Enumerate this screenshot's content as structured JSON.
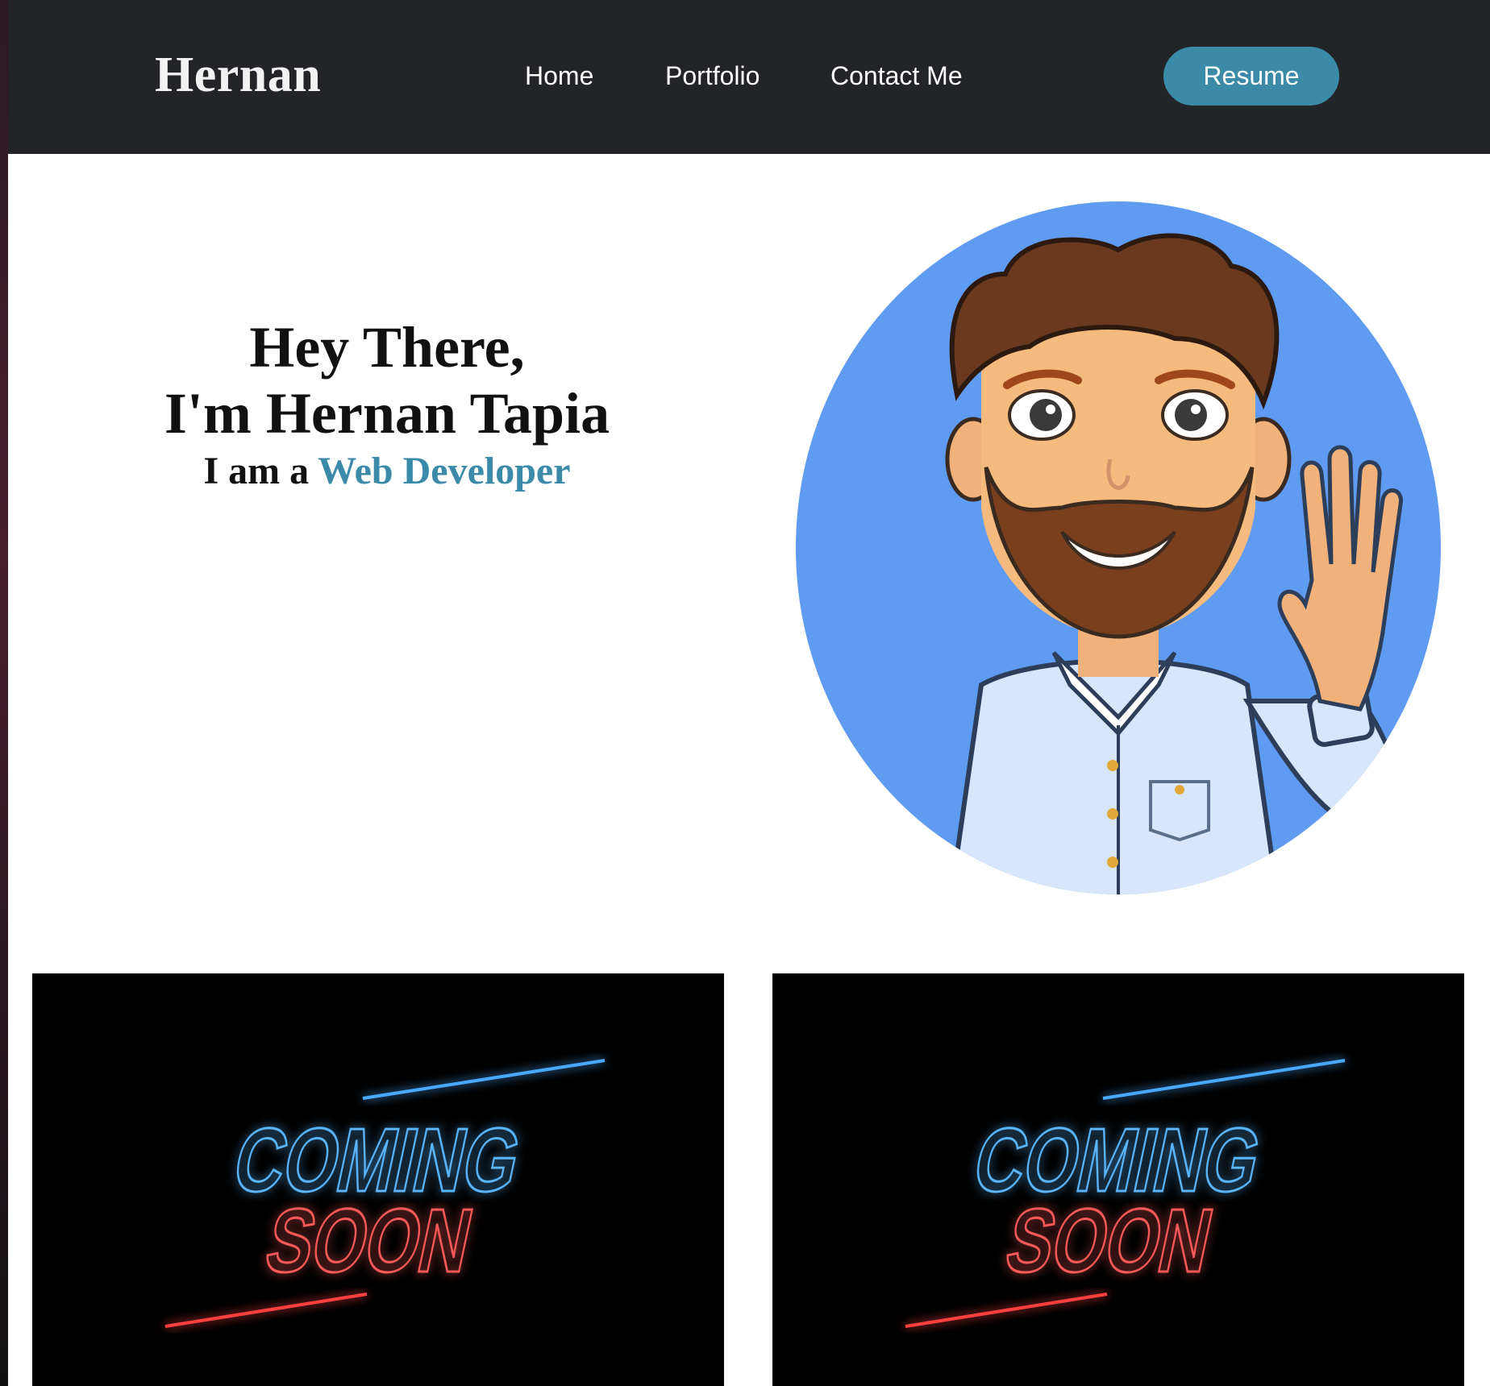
{
  "navbar": {
    "brand": "Hernan",
    "links": [
      {
        "label": "Home"
      },
      {
        "label": "Portfolio"
      },
      {
        "label": "Contact Me"
      }
    ],
    "resume_label": "Resume"
  },
  "hero": {
    "line1": "Hey There,",
    "line2": "I'm Hernan Tapia",
    "line3_prefix": "I am a ",
    "line3_accent": "Web Developer"
  },
  "cards": [
    {
      "line1": "COMING",
      "line2": "SOON"
    },
    {
      "line1": "COMING",
      "line2": "SOON"
    }
  ],
  "colors": {
    "navbar_bg": "#232428",
    "accent": "#3a8aa8",
    "avatar_bg": "#609bf2",
    "neon_blue": "#3aa0ff",
    "neon_red": "#ff3b3b"
  }
}
